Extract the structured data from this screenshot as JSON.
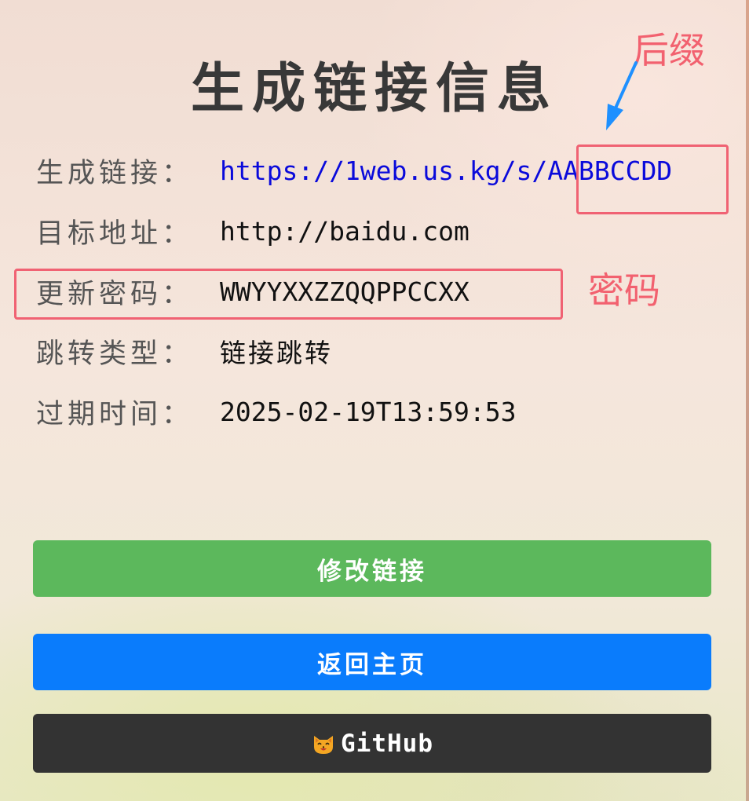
{
  "page": {
    "title": "生成链接信息"
  },
  "info_rows": [
    {
      "label": "生成链接：",
      "value_prefix": "https://1web.us.kg/s/",
      "value_suffix": "AABBCCDD"
    },
    {
      "label": "目标地址：",
      "value": "http://baidu.com"
    },
    {
      "label": "更新密码：",
      "value": "WWYYXXZZQQPPCCXX"
    },
    {
      "label": "跳转类型：",
      "value": "链接跳转"
    },
    {
      "label": "过期时间：",
      "value": "2025-02-19T13:59:53"
    }
  ],
  "buttons": {
    "edit_link": "修改链接",
    "back_home": "返回主页",
    "github": "GitHub"
  },
  "annotations": {
    "suffix": "后缀",
    "password": "密码"
  },
  "colors": {
    "link": "#0a0adb",
    "edit_button": "#5cb85c",
    "home_button": "#0a7cfc",
    "github_button": "#333333",
    "annotation": "#f06273",
    "arrow": "#1e90ff"
  },
  "icons": {
    "github": "cat-face-icon"
  }
}
